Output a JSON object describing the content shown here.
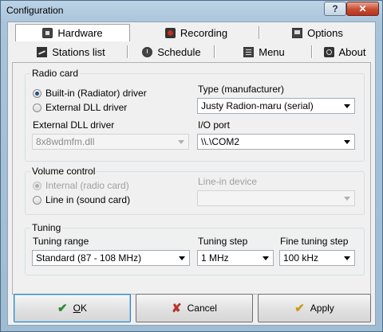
{
  "window": {
    "title": "Configuration"
  },
  "titlebar": {
    "help_glyph": "?",
    "close_glyph": "✕"
  },
  "tabs_row1": [
    {
      "label": "Hardware",
      "icon": "hardware-icon",
      "selected": true
    },
    {
      "label": "Recording",
      "icon": "record-icon"
    },
    {
      "label": "Options",
      "icon": "options-icon"
    }
  ],
  "tabs_row2": [
    {
      "label": "Stations list",
      "icon": "stations-list-icon"
    },
    {
      "label": "Schedule",
      "icon": "clock-icon"
    },
    {
      "label": "Menu",
      "icon": "menu-icon"
    },
    {
      "label": "About",
      "icon": "about-icon"
    }
  ],
  "radio_card": {
    "legend": "Radio card",
    "options": [
      {
        "label": "Built-in (Radiator) driver",
        "checked": true
      },
      {
        "label": "External DLL driver",
        "checked": false
      }
    ],
    "type_label": "Type (manufacturer)",
    "type_value": "Justy Radion-maru (serial)",
    "dll_label": "External DLL driver",
    "dll_value": "8x8wdmfm.dll",
    "io_label": "I/O port",
    "io_value": "\\\\.\\COM2"
  },
  "volume_control": {
    "legend": "Volume control",
    "options": [
      {
        "label": "Internal (radio card)",
        "checked": true,
        "disabled": true
      },
      {
        "label": "Line in (sound card)",
        "checked": false
      }
    ],
    "linein_label": "Line-in device",
    "linein_value": ""
  },
  "tuning": {
    "legend": "Tuning",
    "range_label": "Tuning range",
    "range_value": "Standard (87 - 108 MHz)",
    "step_label": "Tuning step",
    "step_value": "1 MHz",
    "fine_label": "Fine tuning step",
    "fine_value": "100 kHz"
  },
  "buttons": {
    "ok_underlined": "O",
    "ok_rest": "K",
    "cancel_label": "Cancel",
    "apply_label": "Apply",
    "ok_icon": "check-icon",
    "cancel_icon": "x-icon",
    "apply_icon": "check-icon"
  },
  "colors": {
    "titlebar": "#a9c3d9",
    "close_button": "#c74b32",
    "dialog_bg": "#f0f0f0",
    "radio_selected": "#2a4f8a"
  }
}
